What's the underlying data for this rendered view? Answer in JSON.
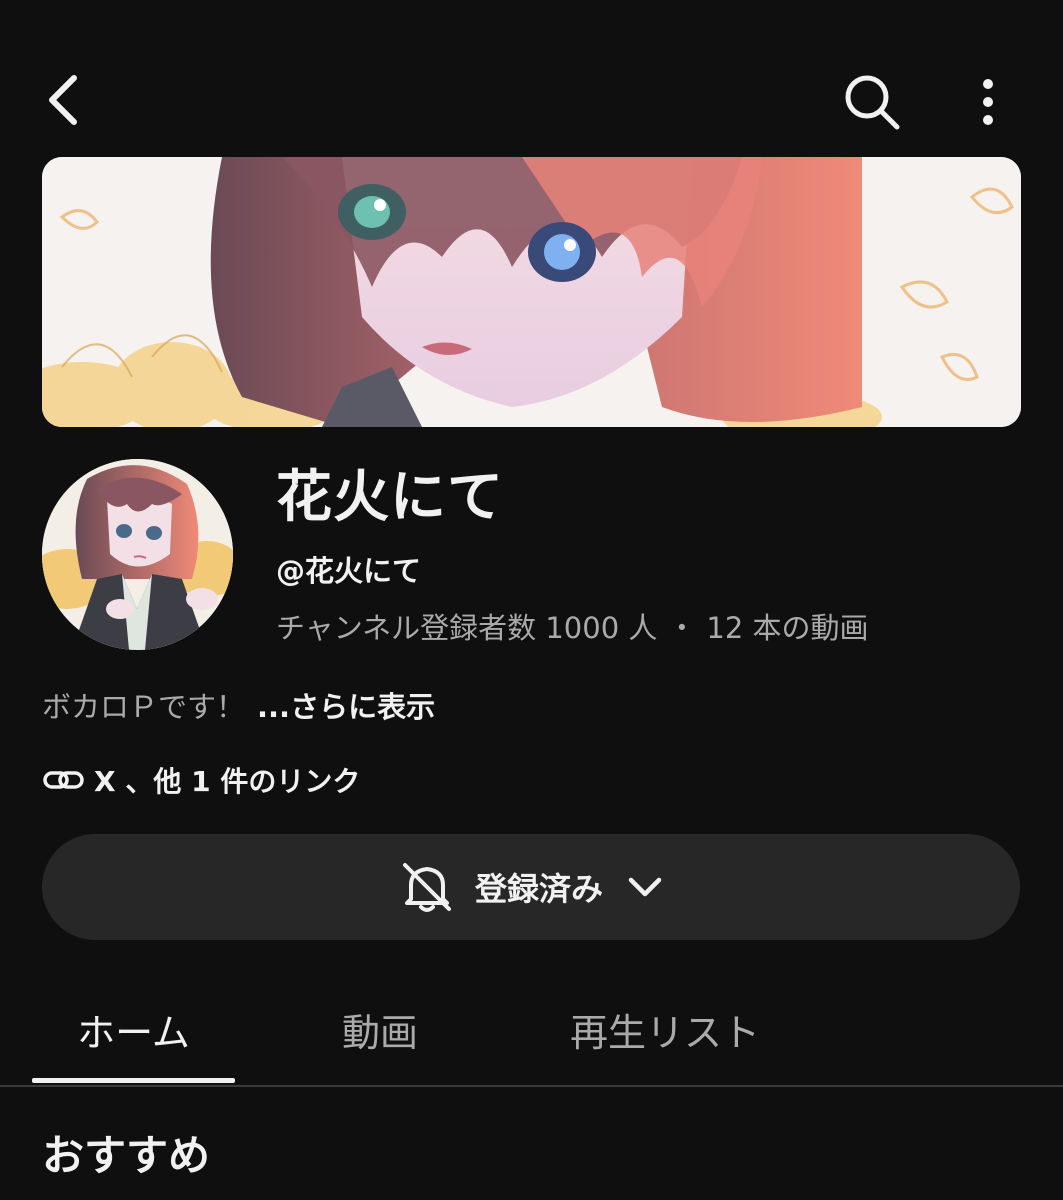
{
  "channel": {
    "name": "花火にて",
    "handle": "@花火にて",
    "subscribers": "チャンネル登録者数 1000 人",
    "separator": "・",
    "video_count": "12 本の動画",
    "description": "ボカロＰです！",
    "description_more": "...さらに表示",
    "links_text": "X 、他 1 件のリンク"
  },
  "subscribe": {
    "label": "登録済み",
    "bell_icon": "bell-off-icon",
    "dropdown_icon": "chevron-down-icon"
  },
  "tabs": [
    {
      "label": "ホーム",
      "active": true
    },
    {
      "label": "動画",
      "active": false
    },
    {
      "label": "再生リスト",
      "active": false
    }
  ],
  "section": {
    "title": "おすすめ"
  },
  "topbar": {
    "back_icon": "back-arrow-icon",
    "search_icon": "search-icon",
    "more_icon": "more-vert-icon"
  },
  "colors": {
    "background": "#0f0f0f",
    "button_bg": "#272727",
    "text_primary": "#f1f1f1",
    "text_secondary": "#aaaaaa"
  }
}
